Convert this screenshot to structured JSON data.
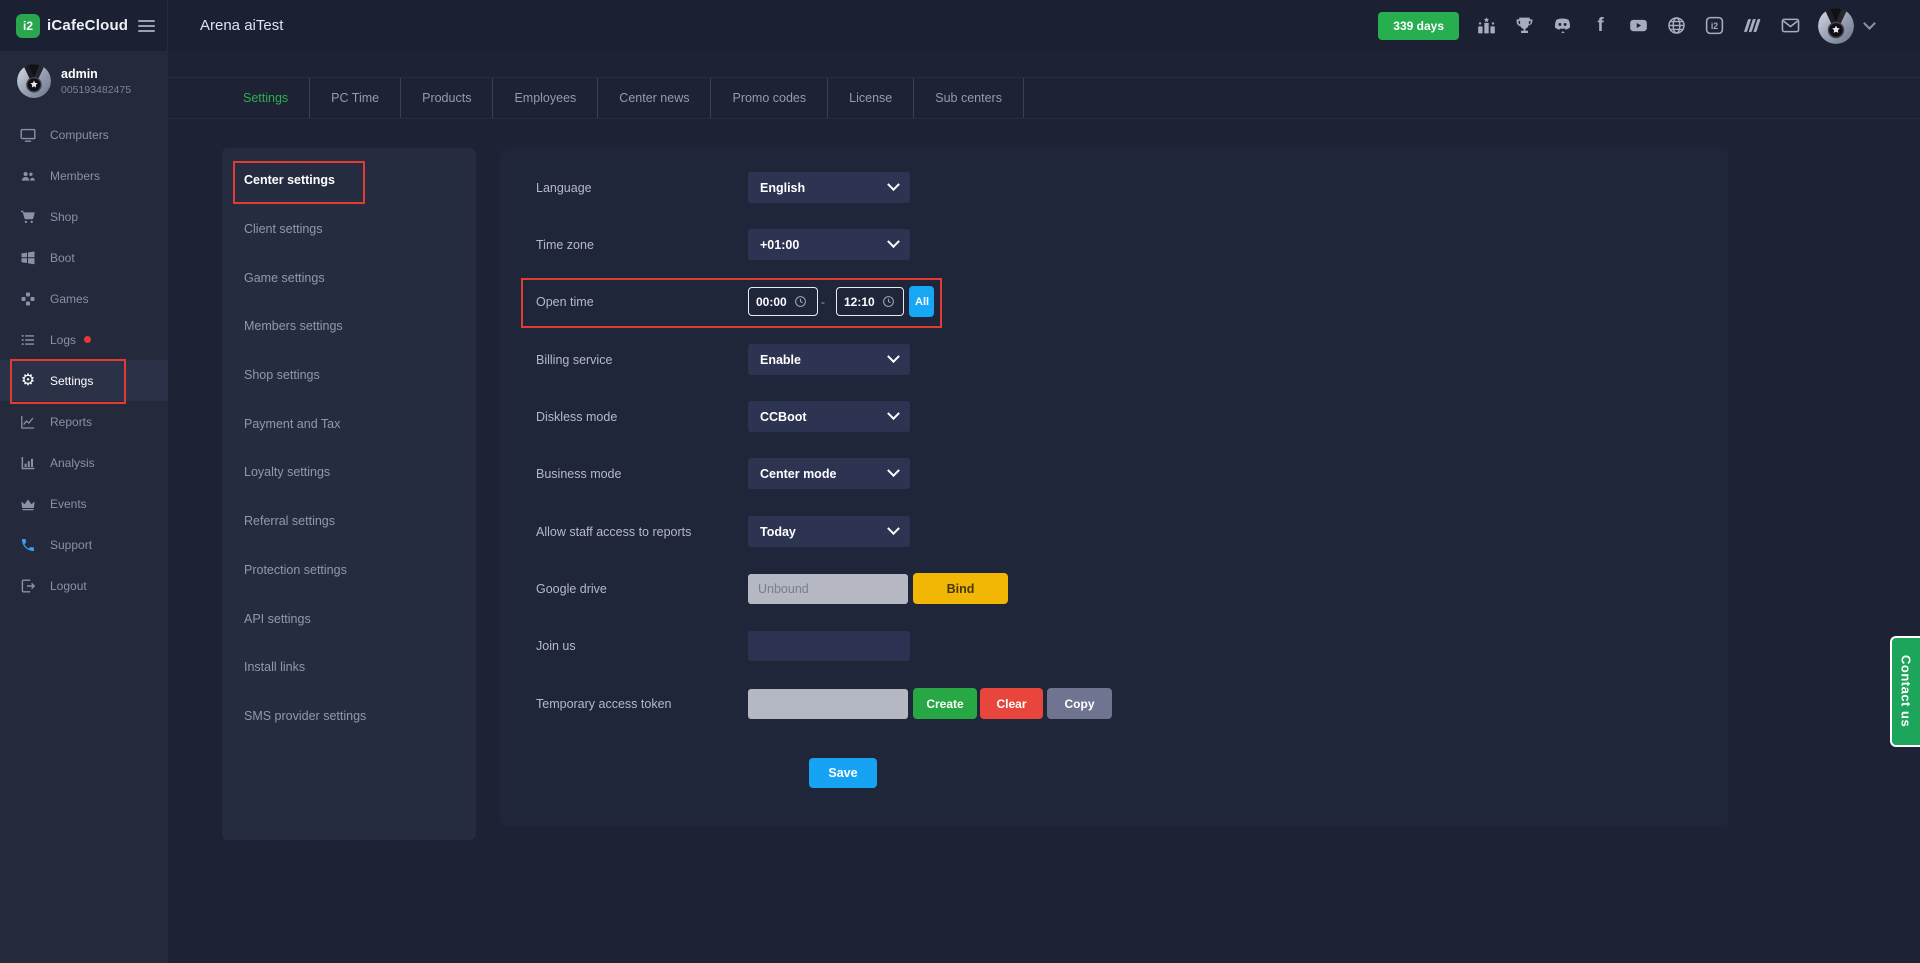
{
  "topbar": {
    "brand": "iCafeCloud",
    "logo_glyph": "i2",
    "title": "Arena aiTest",
    "days_badge": "339 days",
    "facebook_glyph": "f",
    "icons": [
      "ranking",
      "trophy",
      "discord",
      "facebook",
      "youtube",
      "globe",
      "icafecloud",
      "layers",
      "mail"
    ]
  },
  "sidebar": {
    "user": {
      "name": "admin",
      "id": "005193482475"
    },
    "items": [
      {
        "label": "Computers"
      },
      {
        "label": "Members"
      },
      {
        "label": "Shop"
      },
      {
        "label": "Boot"
      },
      {
        "label": "Games"
      },
      {
        "label": "Logs",
        "has_alert": true
      },
      {
        "label": "Settings",
        "active": true
      },
      {
        "label": "Reports"
      },
      {
        "label": "Analysis"
      },
      {
        "label": "Events"
      },
      {
        "label": "Support"
      },
      {
        "label": "Logout"
      }
    ]
  },
  "tabs": [
    {
      "label": "Settings",
      "active": true
    },
    {
      "label": "PC Time"
    },
    {
      "label": "Products"
    },
    {
      "label": "Employees"
    },
    {
      "label": "Center news"
    },
    {
      "label": "Promo codes"
    },
    {
      "label": "License"
    },
    {
      "label": "Sub centers"
    }
  ],
  "submenu": [
    {
      "label": "Center settings",
      "active": true
    },
    {
      "label": "Client settings"
    },
    {
      "label": "Game settings"
    },
    {
      "label": "Members settings"
    },
    {
      "label": "Shop settings"
    },
    {
      "label": "Payment and Tax"
    },
    {
      "label": "Loyalty settings"
    },
    {
      "label": "Referral settings"
    },
    {
      "label": "Protection settings"
    },
    {
      "label": "API settings"
    },
    {
      "label": "Install links"
    },
    {
      "label": "SMS provider settings"
    }
  ],
  "form": {
    "language": {
      "label": "Language",
      "value": "English"
    },
    "timezone": {
      "label": "Time zone",
      "value": "+01:00"
    },
    "open_time": {
      "label": "Open time",
      "from": "00:00",
      "separator": "-",
      "to": "12:10",
      "all_label": "All"
    },
    "billing": {
      "label": "Billing service",
      "value": "Enable"
    },
    "diskless": {
      "label": "Diskless mode",
      "value": "CCBoot"
    },
    "business": {
      "label": "Business mode",
      "value": "Center mode"
    },
    "staff_reports": {
      "label": "Allow staff access to reports",
      "value": "Today"
    },
    "google_drive": {
      "label": "Google drive",
      "placeholder": "Unbound",
      "value": "",
      "button": "Bind"
    },
    "join_us": {
      "label": "Join us",
      "value": ""
    },
    "token": {
      "label": "Temporary access token",
      "value": "",
      "create": "Create",
      "clear": "Clear",
      "copy": "Copy"
    },
    "save": "Save"
  },
  "contact": {
    "label": "Contact us"
  },
  "colors": {
    "accent_green": "#27ae4e",
    "accent_blue": "#16a3f4",
    "warning_yellow": "#f2b705",
    "danger_red": "#e8463d",
    "gray_button": "#6f7590",
    "annotation_red": "#e23b32"
  }
}
